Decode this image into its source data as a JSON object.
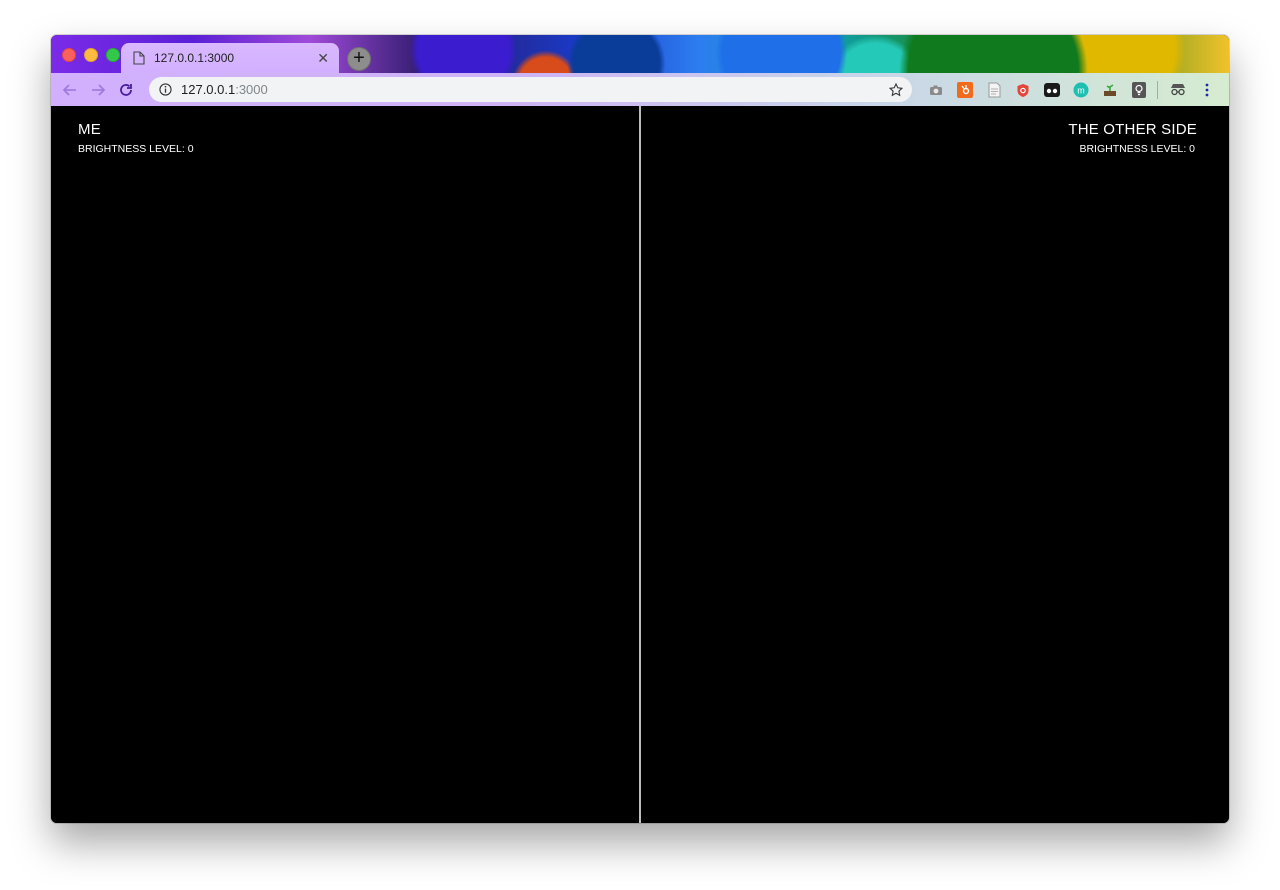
{
  "browser": {
    "tab": {
      "title": "127.0.0.1:3000"
    },
    "address": {
      "host": "127.0.0.1",
      "port": ":3000"
    }
  },
  "left_panel": {
    "title": "ME",
    "brightness_label": "BRIGHTNESS LEVEL: 0"
  },
  "right_panel": {
    "title": "THE OTHER SIDE",
    "brightness_label": "BRIGHTNESS LEVEL: 0"
  },
  "icons": {
    "tab_favicon": "document-icon",
    "tab_close": "close-icon",
    "new_tab": "plus-icon",
    "back": "back-arrow-icon",
    "forward": "forward-arrow-icon",
    "reload": "reload-icon",
    "site_info": "info-icon",
    "bookmark": "star-icon",
    "extensions": [
      "camera-icon",
      "hubspot-icon",
      "page-icon",
      "shield-icon",
      "eyes-icon",
      "m-icon",
      "plant-icon",
      "bulb-icon",
      "spy-icon"
    ],
    "menu": "kebab-menu-icon"
  },
  "colors": {
    "accent": "#7b2be8",
    "page_bg": "#000000",
    "divider": "#bdbdbd",
    "text": "#ffffff"
  }
}
